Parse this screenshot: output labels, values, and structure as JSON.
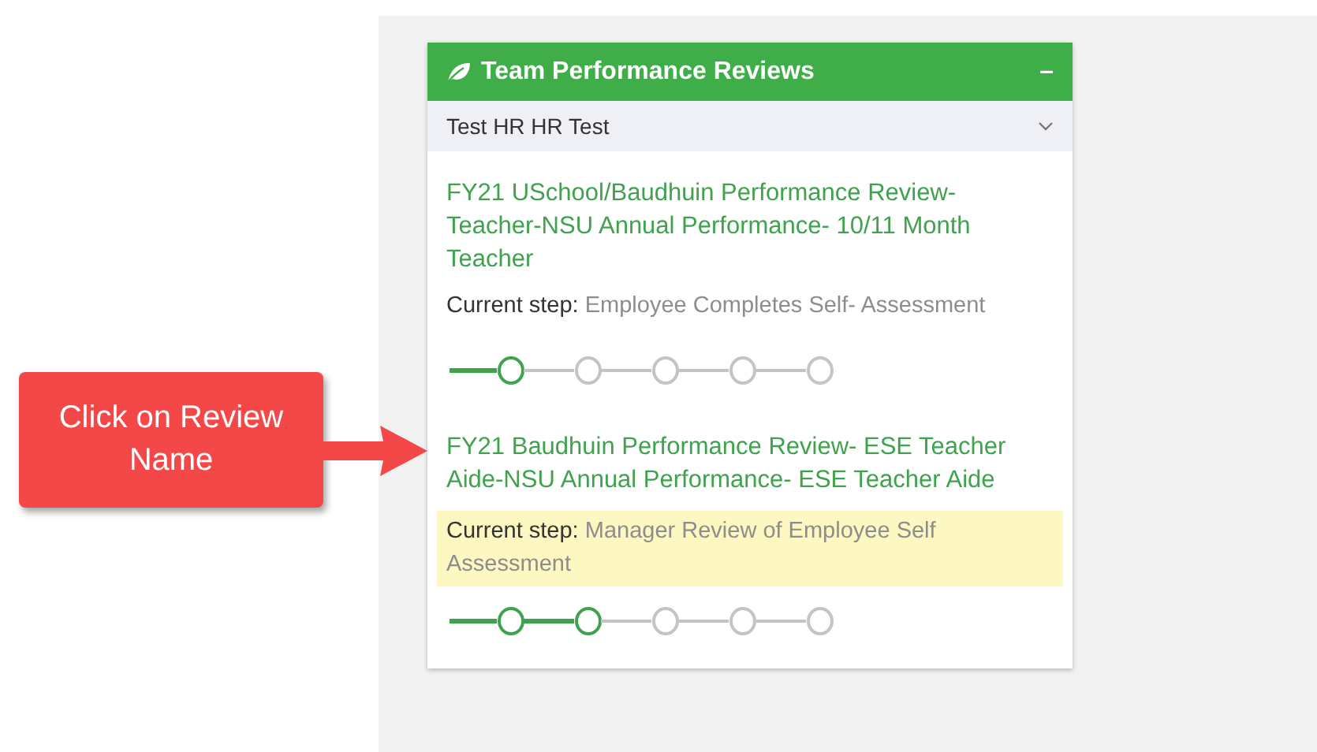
{
  "panel": {
    "title": "Team Performance Reviews",
    "collapse_symbol": "–",
    "employee": "Test HR HR Test"
  },
  "reviews": [
    {
      "name": "FY21 USchool/Baudhuin Performance Review-Teacher-NSU Annual Performance- 10/11 Month Teacher",
      "step_label": "Current step:",
      "step": "Employee Completes Self- Assessment",
      "highlighted": false,
      "steps": [
        {
          "reached": true
        },
        {
          "reached": false
        },
        {
          "reached": false
        },
        {
          "reached": false
        },
        {
          "reached": false
        }
      ]
    },
    {
      "name": "FY21 Baudhuin Performance Review- ESE Teacher Aide-NSU Annual Performance- ESE Teacher Aide",
      "step_label": "Current step:",
      "step": "Manager Review of Employee Self Assessment",
      "highlighted": true,
      "steps": [
        {
          "reached": true
        },
        {
          "reached": true
        },
        {
          "reached": false
        },
        {
          "reached": false
        },
        {
          "reached": false
        }
      ]
    }
  ],
  "callout": {
    "text": "Click on Review Name"
  }
}
